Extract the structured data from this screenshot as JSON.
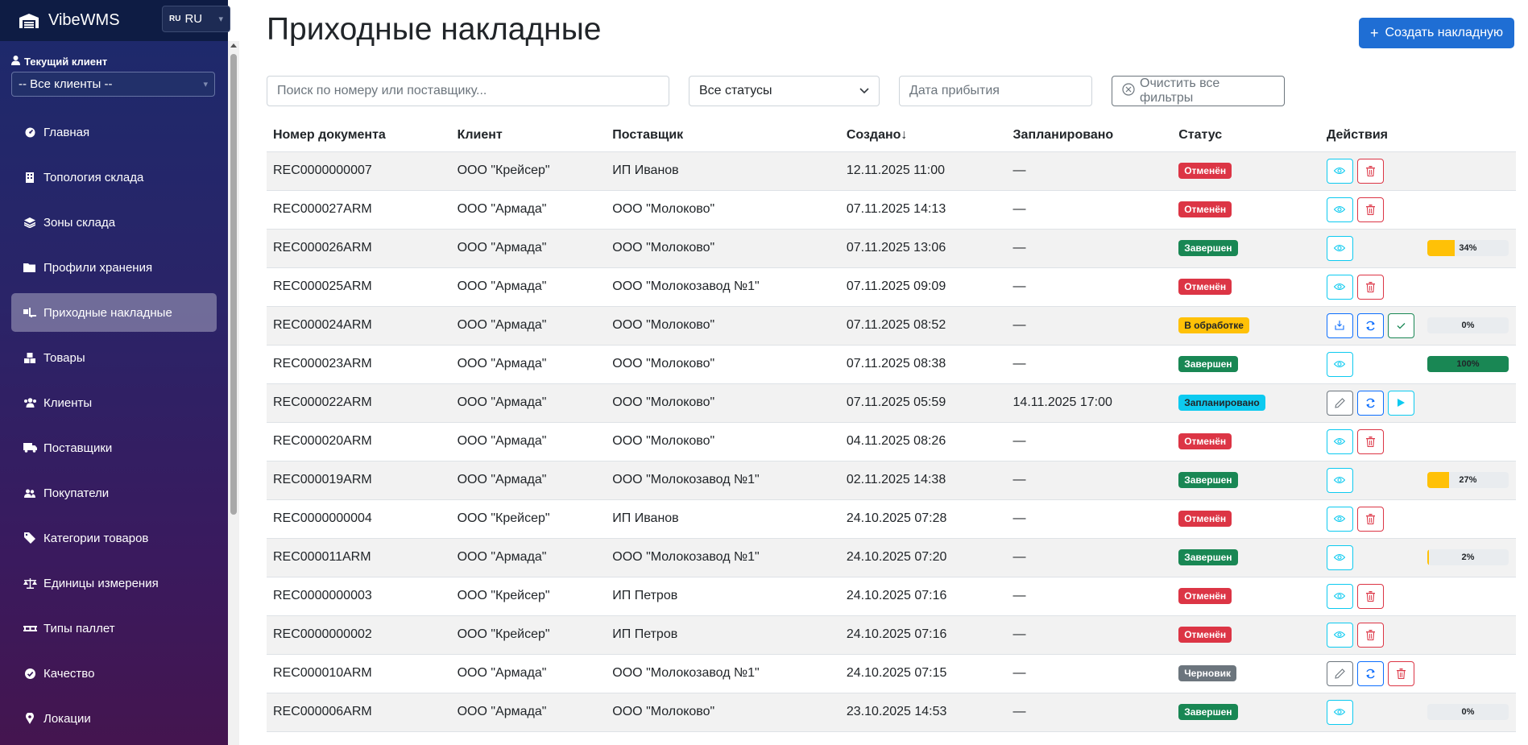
{
  "app": {
    "brand": "VibeWMS",
    "lang_flag": "RU",
    "lang_code": "RU",
    "client_label": "Текущий клиент",
    "client_value": "-- Все клиенты --"
  },
  "nav": [
    {
      "label": "Главная",
      "icon": "dashboard-icon",
      "active": false
    },
    {
      "label": "Топология склада",
      "icon": "building-icon",
      "active": false
    },
    {
      "label": "Зоны склада",
      "icon": "layers-icon",
      "active": false
    },
    {
      "label": "Профили хранения",
      "icon": "folder-icon",
      "active": false
    },
    {
      "label": "Приходные накладные",
      "icon": "truck-loading-icon",
      "active": true
    },
    {
      "label": "Товары",
      "icon": "boxes-icon",
      "active": false
    },
    {
      "label": "Клиенты",
      "icon": "users-icon",
      "active": false
    },
    {
      "label": "Поставщики",
      "icon": "truck-icon",
      "active": false
    },
    {
      "label": "Покупатели",
      "icon": "user-group-icon",
      "active": false
    },
    {
      "label": "Категории товаров",
      "icon": "tag-icon",
      "active": false
    },
    {
      "label": "Единицы измерения",
      "icon": "scale-icon",
      "active": false
    },
    {
      "label": "Типы паллет",
      "icon": "pallet-icon",
      "active": false
    },
    {
      "label": "Качество",
      "icon": "check-circle-icon",
      "active": false
    },
    {
      "label": "Локации",
      "icon": "map-pin-icon",
      "active": false
    }
  ],
  "page": {
    "title": "Приходные накладные",
    "create_label": "Создать накладную",
    "search_placeholder": "Поиск по номеру или поставщику...",
    "status_filter": "Все статусы",
    "date_placeholder": "Дата прибытия",
    "clear_label": "Очистить все фильтры"
  },
  "table": {
    "headers": {
      "number": "Номер документа",
      "client": "Клиент",
      "supplier": "Поставщик",
      "created": "Создано",
      "sort_arrow": "↓",
      "planned": "Запланировано",
      "status": "Статус",
      "actions": "Действия"
    },
    "rows": [
      {
        "number": "REC0000000007",
        "client": "ООО \"Крейсер\"",
        "supplier": "ИП Иванов",
        "created": "12.11.2025 11:00",
        "planned": "—",
        "status": "Отменён",
        "status_type": "canceled",
        "actions": [
          "view",
          "delete"
        ],
        "progress": null
      },
      {
        "number": "REC000027ARM",
        "client": "ООО \"Армада\"",
        "supplier": "ООО \"Молоково\"",
        "created": "07.11.2025 14:13",
        "planned": "—",
        "status": "Отменён",
        "status_type": "canceled",
        "actions": [
          "view",
          "delete"
        ],
        "progress": null
      },
      {
        "number": "REC000026ARM",
        "client": "ООО \"Армада\"",
        "supplier": "ООО \"Молоково\"",
        "created": "07.11.2025 13:06",
        "planned": "—",
        "status": "Завершен",
        "status_type": "done",
        "actions": [
          "view"
        ],
        "progress": 34,
        "progress_label": "34%"
      },
      {
        "number": "REC000025ARM",
        "client": "ООО \"Армада\"",
        "supplier": "ООО \"Молокозавод №1\"",
        "created": "07.11.2025 09:09",
        "planned": "—",
        "status": "Отменён",
        "status_type": "canceled",
        "actions": [
          "view",
          "delete"
        ],
        "progress": null
      },
      {
        "number": "REC000024ARM",
        "client": "ООО \"Армада\"",
        "supplier": "ООО \"Молоково\"",
        "created": "07.11.2025 08:52",
        "planned": "—",
        "status": "В обработке",
        "status_type": "processing",
        "actions": [
          "receive",
          "sync",
          "confirm"
        ],
        "progress": 0,
        "progress_label": "0%"
      },
      {
        "number": "REC000023ARM",
        "client": "ООО \"Армада\"",
        "supplier": "ООО \"Молоково\"",
        "created": "07.11.2025 08:38",
        "planned": "—",
        "status": "Завершен",
        "status_type": "done",
        "actions": [
          "view"
        ],
        "progress": 100,
        "progress_label": "100%"
      },
      {
        "number": "REC000022ARM",
        "client": "ООО \"Армада\"",
        "supplier": "ООО \"Молоково\"",
        "created": "07.11.2025 05:59",
        "planned": "14.11.2025 17:00",
        "status": "Запланировано",
        "status_type": "planned",
        "actions": [
          "edit",
          "sync",
          "start"
        ],
        "progress": null
      },
      {
        "number": "REC000020ARM",
        "client": "ООО \"Армада\"",
        "supplier": "ООО \"Молоково\"",
        "created": "04.11.2025 08:26",
        "planned": "—",
        "status": "Отменён",
        "status_type": "canceled",
        "actions": [
          "view",
          "delete"
        ],
        "progress": null
      },
      {
        "number": "REC000019ARM",
        "client": "ООО \"Армада\"",
        "supplier": "ООО \"Молокозавод №1\"",
        "created": "02.11.2025 14:38",
        "planned": "—",
        "status": "Завершен",
        "status_type": "done",
        "actions": [
          "view"
        ],
        "progress": 27,
        "progress_label": "27%"
      },
      {
        "number": "REC0000000004",
        "client": "ООО \"Крейсер\"",
        "supplier": "ИП Иванов",
        "created": "24.10.2025 07:28",
        "planned": "—",
        "status": "Отменён",
        "status_type": "canceled",
        "actions": [
          "view",
          "delete"
        ],
        "progress": null
      },
      {
        "number": "REC000011ARM",
        "client": "ООО \"Армада\"",
        "supplier": "ООО \"Молокозавод №1\"",
        "created": "24.10.2025 07:20",
        "planned": "—",
        "status": "Завершен",
        "status_type": "done",
        "actions": [
          "view"
        ],
        "progress": 2,
        "progress_label": "2%"
      },
      {
        "number": "REC0000000003",
        "client": "ООО \"Крейсер\"",
        "supplier": "ИП Петров",
        "created": "24.10.2025 07:16",
        "planned": "—",
        "status": "Отменён",
        "status_type": "canceled",
        "actions": [
          "view",
          "delete"
        ],
        "progress": null
      },
      {
        "number": "REC0000000002",
        "client": "ООО \"Крейсер\"",
        "supplier": "ИП Петров",
        "created": "24.10.2025 07:16",
        "planned": "—",
        "status": "Отменён",
        "status_type": "canceled",
        "actions": [
          "view",
          "delete"
        ],
        "progress": null
      },
      {
        "number": "REC000010ARM",
        "client": "ООО \"Армада\"",
        "supplier": "ООО \"Молокозавод №1\"",
        "created": "24.10.2025 07:15",
        "planned": "—",
        "status": "Черновик",
        "status_type": "draft",
        "actions": [
          "edit",
          "sync",
          "delete"
        ],
        "progress": null
      },
      {
        "number": "REC000006ARM",
        "client": "ООО \"Армада\"",
        "supplier": "ООО \"Молоково\"",
        "created": "23.10.2025 14:53",
        "planned": "—",
        "status": "Завершен",
        "status_type": "done",
        "actions": [
          "view"
        ],
        "progress": 0,
        "progress_label": "0%"
      }
    ]
  },
  "colors": {
    "primary": "#1f6ed4",
    "danger": "#dc3545",
    "success": "#198754",
    "warning": "#ffc107",
    "info": "#0dcaf0",
    "secondary": "#6c757d"
  }
}
